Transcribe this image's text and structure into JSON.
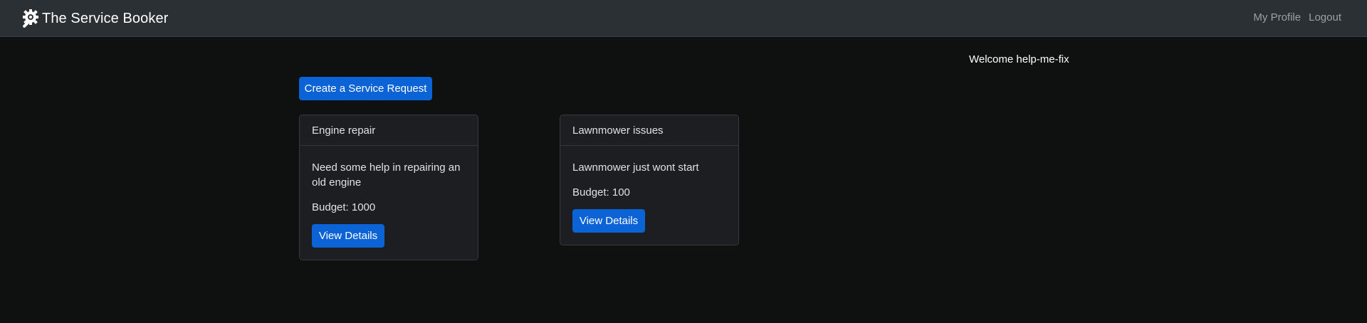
{
  "navbar": {
    "brand": "The Service Booker",
    "brand_icon": "gear-wrench-icon",
    "links": [
      "My Profile",
      "Logout"
    ]
  },
  "welcome": "Welcome help-me-fix",
  "create_button": "Create a Service Request",
  "requests": [
    {
      "title": "Engine repair",
      "description": "Need some help in repairing an old engine",
      "budget": "Budget: 1000",
      "button": "View Details"
    },
    {
      "title": "Lawnmower issues",
      "description": "Lawnmower just wont start",
      "budget": "Budget: 100",
      "button": "View Details"
    }
  ],
  "colors": {
    "background": "#0f1111",
    "navbar": "#2b3035",
    "card": "#1c1e21",
    "primary_button": "#0b63d6"
  }
}
